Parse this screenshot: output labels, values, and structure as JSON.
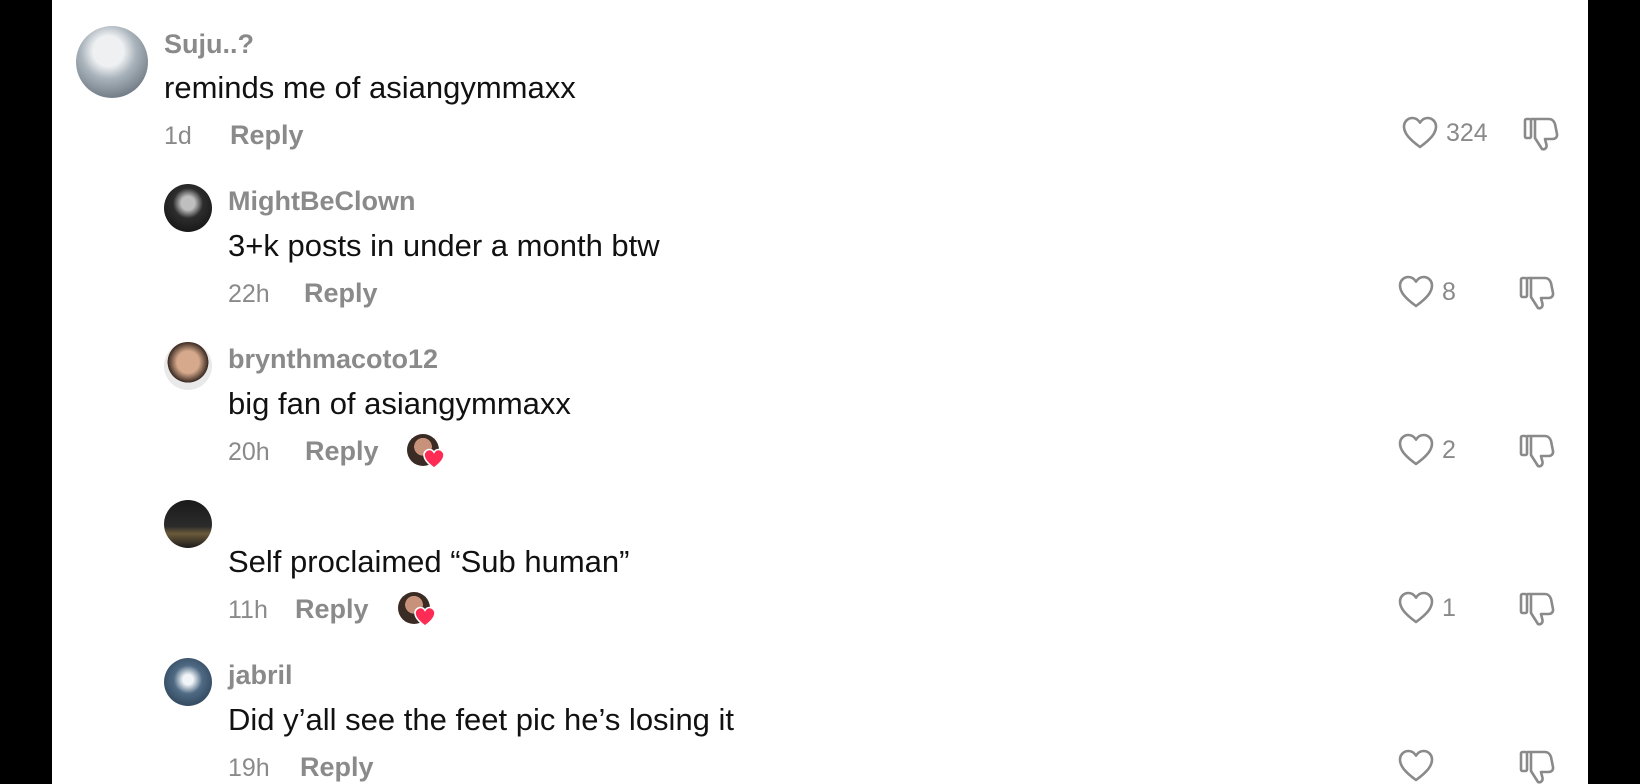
{
  "comments": [
    {
      "username": "Suju..?",
      "text": "reminds me of asiangymmaxx",
      "time": "1d",
      "reply": "Reply",
      "likes": "324",
      "creator_liked": false
    },
    {
      "username": "MightBeClown",
      "text": "3+k posts in under a month btw",
      "time": "22h",
      "reply": "Reply",
      "likes": "8",
      "creator_liked": false
    },
    {
      "username": "brynthmacoto12",
      "text": "big fan of asiangymmaxx",
      "time": "20h",
      "reply": "Reply",
      "likes": "2",
      "creator_liked": true
    },
    {
      "username": "",
      "text": "Self proclaimed “Sub human”",
      "time": "11h",
      "reply": "Reply",
      "likes": "1",
      "creator_liked": true
    },
    {
      "username": "jabril",
      "text": "Did y’all see the feet pic he’s losing it",
      "time": "19h",
      "reply": "Reply",
      "likes": "",
      "creator_liked": false
    }
  ],
  "colors": {
    "creator_heart": "#fe2c55",
    "secondary_text": "#8a8a8a"
  },
  "icons": {
    "like": "heart-outline-icon",
    "dislike": "thumbs-down-icon",
    "creator_like": "creator-liked-heart-icon"
  }
}
